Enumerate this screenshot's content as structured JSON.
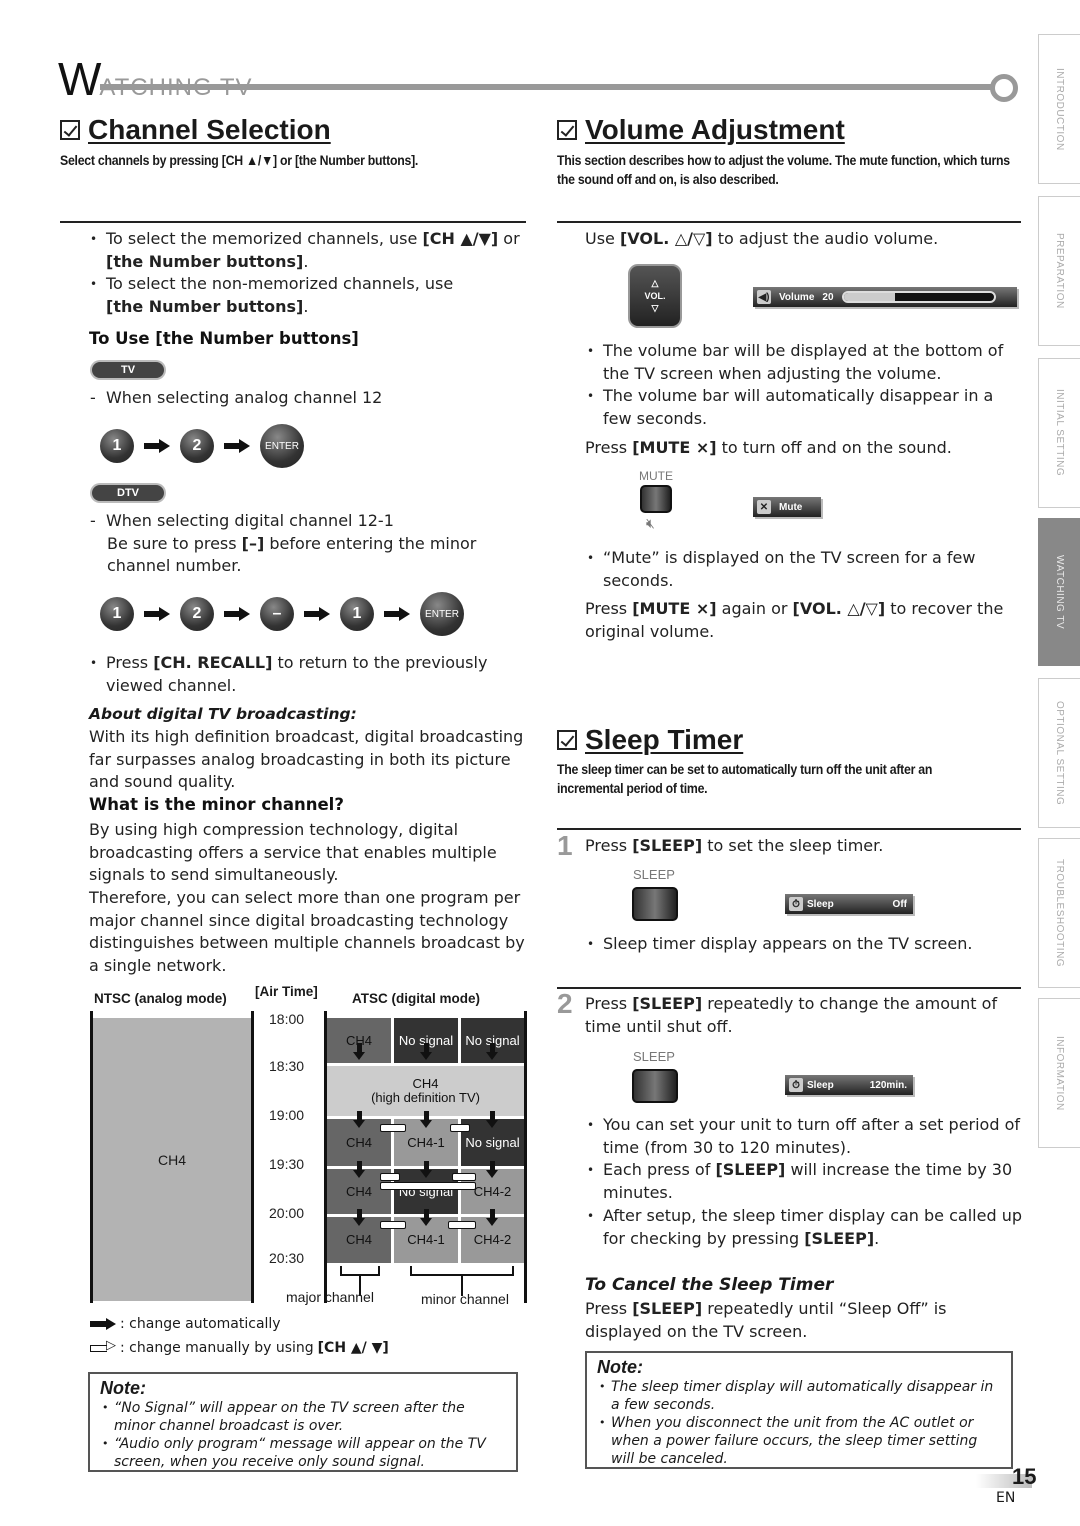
{
  "chapter": {
    "initial": "W",
    "rest": "ATCHING TV"
  },
  "side_tabs": [
    {
      "label": "INTRODUCTION",
      "active": false
    },
    {
      "label": "PREPARATION",
      "active": false
    },
    {
      "label": "INITIAL  SETTING",
      "active": false
    },
    {
      "label": "WATCHING  TV",
      "active": true
    },
    {
      "label": "OPTIONAL  SETTING",
      "active": false
    },
    {
      "label": "TROUBLESHOOTING",
      "active": false
    },
    {
      "label": "INFORMATION",
      "active": false
    }
  ],
  "channel_selection": {
    "title": "Channel Selection",
    "description": "Select channels by pressing [CH ▲/▼] or [the Number buttons].",
    "bullets": [
      {
        "pre": "To select the memorized channels, use ",
        "bold1": "[CH ▲/▼]",
        "mid": " or ",
        "bold2": "[the Number buttons]",
        "post": "."
      },
      {
        "pre": "To select the non-memorized channels, use ",
        "bold1": "[the Number buttons]",
        "post": "."
      }
    ],
    "number_buttons_heading": "To Use [the Number buttons]",
    "tv_mode_label": "TV",
    "analog_note": "When selecting analog channel 12",
    "analog_sequence": [
      "1",
      "2",
      "ENTER"
    ],
    "dtv_mode_label": "DTV",
    "digital_note_line1": "When selecting digital channel 12-1",
    "digital_note_pre": "Be sure to press ",
    "digital_note_bold": "[–]",
    "digital_note_post": " before entering the minor channel number.",
    "digital_sequence": [
      "1",
      "2",
      "–",
      "1",
      "ENTER"
    ],
    "recall": {
      "pre": "Press ",
      "bold": "[CH. RECALL]",
      "post": " to return to the previously viewed channel."
    },
    "about_heading": "About digital TV broadcasting:",
    "about_text": "With its high definition broadcast, digital broadcasting far surpasses analog broadcasting in both its picture and sound quality.",
    "minor_heading": "What is the minor channel?",
    "minor_text1": "By using high compression technology, digital broadcasting offers a service that enables multiple signals to send simultaneously.",
    "minor_text2": "Therefore, you can select more than one program per major channel since digital broadcasting technology distinguishes between multiple channels broadcast by a single network."
  },
  "diagram": {
    "ntsc_header": "NTSC (analog mode)",
    "airtime_header": "[Air Time]",
    "atsc_header": "ATSC (digital mode)",
    "ntsc_channel": "CH4",
    "times": [
      "18:00",
      "18:30",
      "19:00",
      "19:30",
      "20:00",
      "20:30"
    ],
    "rows": [
      [
        "CH4",
        "No signal",
        "No signal"
      ],
      [
        "CH4\n(high definition TV)"
      ],
      [
        "CH4",
        "CH4-1",
        "No signal"
      ],
      [
        "CH4",
        "No signal",
        "CH4-2"
      ],
      [
        "CH4",
        "CH4-1",
        "CH4-2"
      ]
    ],
    "hd_line1": "CH4",
    "hd_line2": "(high definition TV)",
    "major_label": "major channel",
    "minor_label": "minor channel",
    "legend_auto": ": change automatically",
    "legend_manual_pre": ": change manually by using ",
    "legend_manual_bold": "[CH ▲/ ▼]"
  },
  "note_left": {
    "title": "Note:",
    "items": [
      "“No Signal” will appear on the TV screen after the minor channel broadcast is over.",
      "“Audio only program“ message will appear on the TV screen, when you receive only sound signal."
    ]
  },
  "volume": {
    "title": "Volume Adjustment",
    "description": "This section describes how to adjust the volume. The mute function, which turns the sound off and on, is also described.",
    "use_pre": "Use ",
    "use_bold": "[VOL. △/▽]",
    "use_post": " to adjust the audio volume.",
    "remote_up": "△",
    "remote_label": "VOL.",
    "remote_down": "▽",
    "osd_label": "Volume",
    "osd_value": "20",
    "osd_fill_fraction": 0.34,
    "bullets": [
      "The volume bar will be displayed at the bottom of the TV screen when adjusting the volume.",
      "The volume bar will automatically disappear in a few seconds."
    ],
    "mute_pre": "Press ",
    "mute_bold": "[MUTE ⨯]",
    "mute_post": " to turn off and on the sound.",
    "mute_button_label": "MUTE",
    "mute_osd_label": "Mute",
    "mute_bullet": "“Mute” is displayed on the TV screen for a few seconds.",
    "recover_pre": "Press ",
    "recover_bold1": "[MUTE ⨯]",
    "recover_mid": " again or ",
    "recover_bold2": "[VOL. △/▽]",
    "recover_post": " to recover the original volume."
  },
  "sleep": {
    "title": "Sleep Timer",
    "description": "The sleep timer can be set to automatically turn off the unit after an incremental period of time.",
    "step1_num": "1",
    "step1_pre": "Press ",
    "step1_bold": "[SLEEP]",
    "step1_post": " to set the sleep timer.",
    "button_label": "SLEEP",
    "osd_label": "Sleep",
    "osd1_value": "Off",
    "step1_bullet": "Sleep timer display appears on the TV screen.",
    "step2_num": "2",
    "step2_pre": "Press ",
    "step2_bold": "[SLEEP]",
    "step2_post": " repeatedly to change the amount of time until shut off.",
    "osd2_value": "120min.",
    "step2_bullets": [
      {
        "pre": "You can set your unit to turn off after a set period of time (from 30 to 120 minutes).",
        "bold": "",
        "post": ""
      },
      {
        "pre": "Each press of ",
        "bold": "[SLEEP]",
        "post": " will increase the time by 30 minutes."
      },
      {
        "pre": "After setup, the sleep timer display can be called up for checking by pressing ",
        "bold": "[SLEEP]",
        "post": "."
      }
    ],
    "cancel_heading": "To Cancel the Sleep Timer",
    "cancel_pre": "Press ",
    "cancel_bold": "[SLEEP]",
    "cancel_post": " repeatedly until “Sleep Off” is displayed on the TV screen."
  },
  "note_right": {
    "title": "Note:",
    "items": [
      "The sleep timer display will automatically disappear in a few seconds.",
      "When you disconnect the unit from the AC outlet or when a power failure occurs, the sleep timer setting will be canceled."
    ]
  },
  "footer": {
    "page_number": "15",
    "language": "EN"
  }
}
